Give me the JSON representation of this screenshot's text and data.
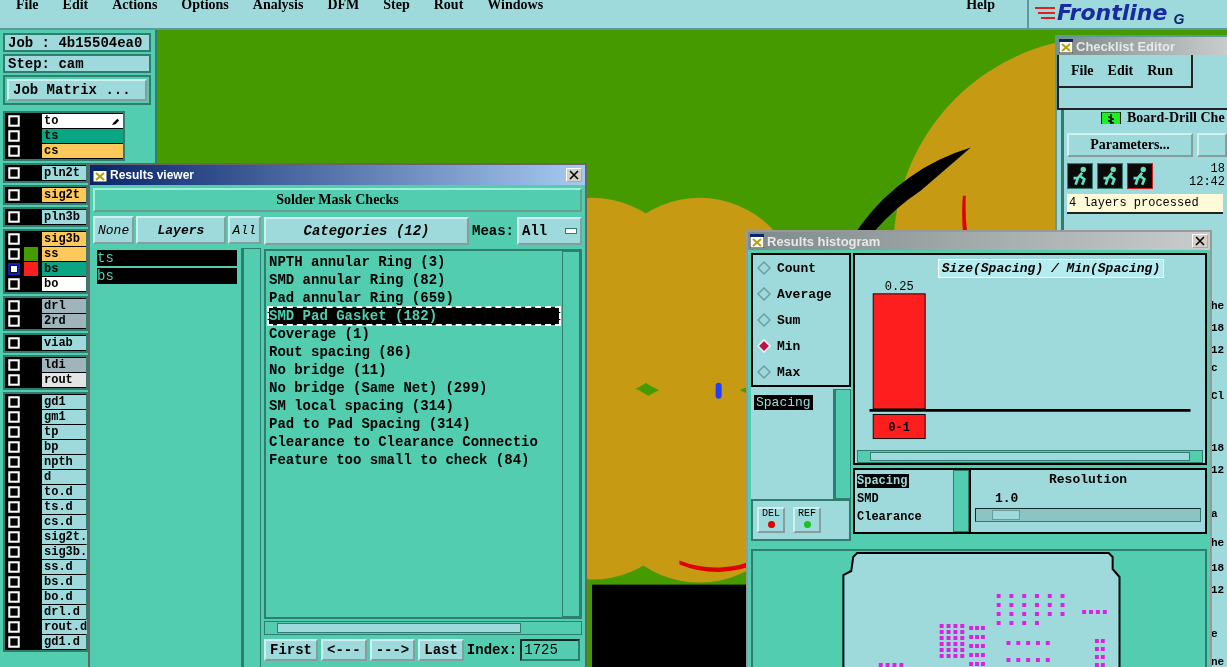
{
  "menu": [
    {
      "label": "File"
    },
    {
      "label": "Edit"
    },
    {
      "label": "Actions"
    },
    {
      "label": "Options"
    },
    {
      "label": "Analysis"
    },
    {
      "label": "DFM"
    },
    {
      "label": "Step"
    },
    {
      "label": "Rout"
    },
    {
      "label": "Windows"
    }
  ],
  "help": "Help",
  "logo": "Frontline",
  "logo_tail": "G",
  "job": {
    "job": "Job : 4b15504ea0",
    "step": "Step: cam",
    "matrix_button": "Job Matrix ..."
  },
  "layer_groups": [
    [
      {
        "name": "to",
        "color": "#ffffff",
        "focused": false,
        "work": true
      },
      {
        "name": "ts",
        "color": "#0aa582",
        "focused": false,
        "work": false
      },
      {
        "name": "cs",
        "color": "#ffc85a",
        "focused": false,
        "work": false
      }
    ],
    [
      {
        "name": "pln2t",
        "color": "#9edadb",
        "focused": false,
        "work": false
      }
    ],
    [
      {
        "name": "sig2t",
        "color": "#ffc85a",
        "focused": false,
        "work": false
      }
    ],
    [
      {
        "name": "pln3b",
        "color": "#9edadb",
        "focused": false,
        "work": false
      }
    ],
    [
      {
        "name": "sig3b",
        "color": "#ffc85a",
        "focused": false,
        "work": false
      },
      {
        "name": "ss",
        "color": "#ffc85a",
        "swatch": {
          "color": "#459a00"
        },
        "focused": false,
        "work": false
      },
      {
        "name": "bs",
        "color": "#0aa582",
        "swatch": {
          "color": "#ff1e1e"
        },
        "focused": true,
        "work": false
      },
      {
        "name": "bo",
        "color": "#ffffff",
        "focused": false,
        "work": false
      }
    ],
    [
      {
        "name": "drl",
        "color": "#a0b4bc",
        "focused": false,
        "work": false
      },
      {
        "name": "2rd",
        "color": "#a0b4bc",
        "focused": false,
        "work": false
      }
    ],
    [
      {
        "name": "viab",
        "color": "#9edadb",
        "focused": false,
        "work": false
      }
    ],
    [
      {
        "name": "ldi",
        "color": "#a0b4bc",
        "focused": false,
        "work": false
      },
      {
        "name": "rout",
        "color": "#e4e4e4",
        "focused": false,
        "work": false
      }
    ],
    [
      {
        "name": "gd1",
        "color": "#9edadb",
        "focused": false,
        "work": false
      },
      {
        "name": "gm1",
        "color": "#9edadb",
        "focused": false,
        "work": false
      },
      {
        "name": "tp",
        "color": "#9edadb",
        "focused": false,
        "work": false
      },
      {
        "name": "bp",
        "color": "#9edadb",
        "focused": false,
        "work": false
      },
      {
        "name": "npth",
        "color": "#9edadb",
        "focused": false,
        "work": false
      },
      {
        "name": "d",
        "color": "#9edadb",
        "focused": false,
        "work": false
      },
      {
        "name": "to.d",
        "color": "#9edadb",
        "focused": false,
        "work": false
      },
      {
        "name": "ts.d",
        "color": "#9edadb",
        "focused": false,
        "work": false
      },
      {
        "name": "cs.d",
        "color": "#9edadb",
        "focused": false,
        "work": false
      },
      {
        "name": "sig2t.",
        "color": "#9edadb",
        "focused": false,
        "work": false
      },
      {
        "name": "sig3b.",
        "color": "#9edadb",
        "focused": false,
        "work": false
      },
      {
        "name": "ss.d",
        "color": "#9edadb",
        "focused": false,
        "work": false
      },
      {
        "name": "bs.d",
        "color": "#9edadb",
        "focused": false,
        "work": false
      },
      {
        "name": "bo.d",
        "color": "#9edadb",
        "focused": false,
        "work": false
      },
      {
        "name": "drl.d",
        "color": "#9edadb",
        "focused": false,
        "work": false
      },
      {
        "name": "rout.d",
        "color": "#9edadb",
        "focused": false,
        "work": false
      },
      {
        "name": "gd1.d",
        "color": "#9edadb",
        "focused": false,
        "work": false
      }
    ]
  ],
  "results_viewer": {
    "title": "Results viewer",
    "header": "Solder Mask Checks",
    "layer_buttons": {
      "none": "None",
      "layers": "Layers",
      "all": "All"
    },
    "layers": [
      {
        "name": "ts",
        "selected": true
      },
      {
        "name": "bs",
        "selected": true
      }
    ],
    "categories_button": "Categories (12)",
    "meas_label": "Meas:",
    "meas_value": "All",
    "categories": [
      {
        "label": "NPTH annular Ring (3)",
        "selected": false
      },
      {
        "label": "SMD annular Ring (82)",
        "selected": false
      },
      {
        "label": "Pad annular Ring (659)",
        "selected": false
      },
      {
        "label": "SMD Pad Gasket (182)",
        "selected": true
      },
      {
        "label": "Coverage (1)",
        "selected": false
      },
      {
        "label": "Rout spacing (86)",
        "selected": false
      },
      {
        "label": "No bridge (11)",
        "selected": false
      },
      {
        "label": "No bridge (Same Net) (299)",
        "selected": false
      },
      {
        "label": "SM local spacing (314)",
        "selected": false
      },
      {
        "label": "Pad to Pad Spacing (314)",
        "selected": false
      },
      {
        "label": "Clearance to Clearance Connectio",
        "selected": false
      },
      {
        "label": "Feature too small to check (84)",
        "selected": false
      }
    ],
    "nav": [
      "First",
      "<---",
      "--->",
      "Last"
    ],
    "index_label": "Index:",
    "index_value": "1725"
  },
  "checklist_editor": {
    "title": "Checklist Editor",
    "menu": [
      "File",
      "Edit",
      "Run"
    ],
    "check_name": "Board-Drill Che",
    "parameters_button": "Parameters...",
    "date": "18",
    "time": "12:42",
    "status": "4 layers processed",
    "edge_texts": [
      "he",
      "18",
      "12",
      "c",
      "Cl",
      "18",
      "12",
      "a",
      "he",
      "18",
      "12",
      "e",
      "ne"
    ]
  },
  "histogram": {
    "title": "Results histogram",
    "modes": [
      {
        "label": "Count",
        "selected": false
      },
      {
        "label": "Average",
        "selected": false
      },
      {
        "label": "Sum",
        "selected": false
      },
      {
        "label": "Min",
        "selected": true
      },
      {
        "label": "Max",
        "selected": false
      }
    ],
    "attributes": [
      {
        "label": "Spacing",
        "selected": true
      }
    ],
    "del_button": "DEL",
    "ref_button": "REF",
    "chart_title": "Size(Spacing) / Min(Spacing)",
    "bins": [
      {
        "label": "0-1",
        "value_label": "0.25"
      }
    ],
    "measures": [
      {
        "label": "Spacing",
        "selected": true
      },
      {
        "label": "SMD",
        "selected": false
      },
      {
        "label": "Clearance",
        "selected": false
      }
    ],
    "resolution_label": "Resolution",
    "resolution_value": "1.0",
    "resolution": {
      "level": 0.07
    }
  }
}
